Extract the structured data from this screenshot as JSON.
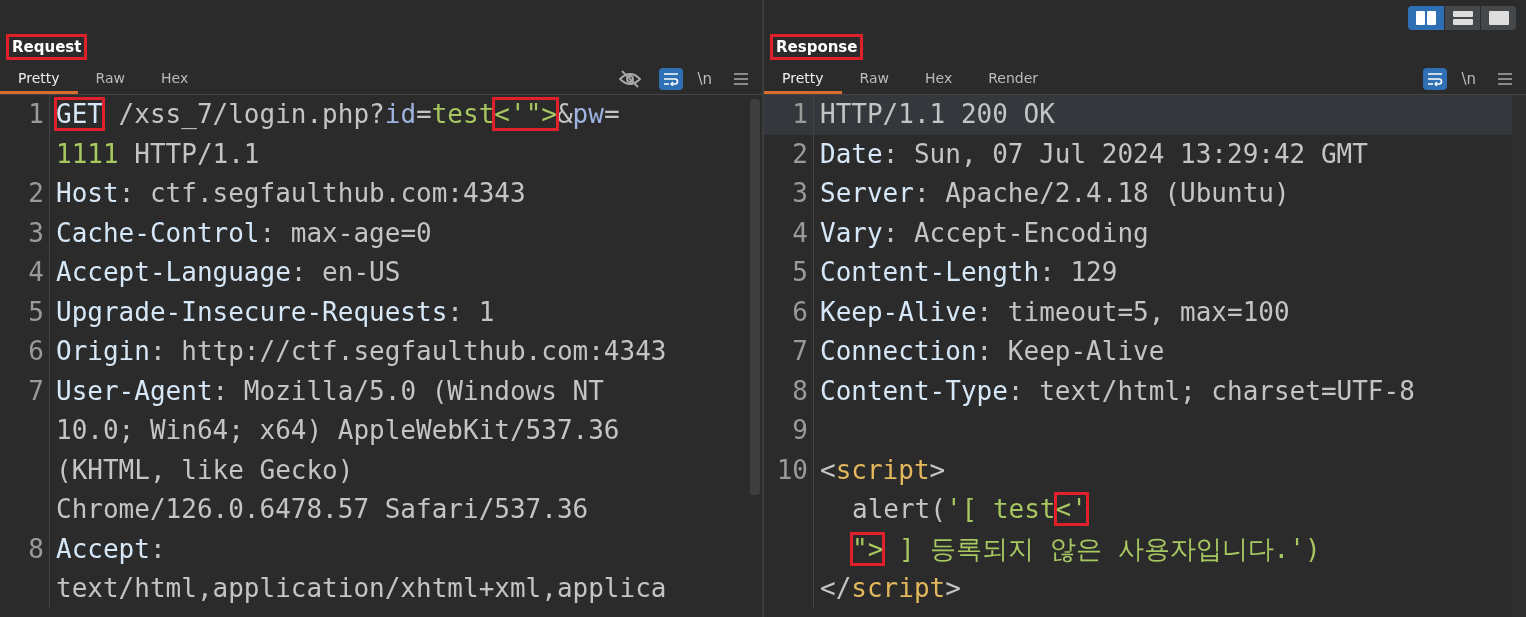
{
  "panes": [
    {
      "title": "Request",
      "title_marked": true,
      "tabs": [
        {
          "label": "Pretty",
          "selected": true
        },
        {
          "label": "Raw",
          "selected": false
        },
        {
          "label": "Hex",
          "selected": false
        }
      ],
      "tools": [
        {
          "kind": "eye"
        },
        {
          "kind": "wrap",
          "on": true
        },
        {
          "kind": "newline",
          "label": "\\n"
        },
        {
          "kind": "menu"
        }
      ],
      "rows": [
        {
          "number": "1",
          "segs": [
            {
              "text": "GET",
              "kind": "key",
              "marked": true
            },
            {
              "text": " /xss_7/login.php?",
              "kind": "plain",
              "marked": false
            },
            {
              "text": "id",
              "kind": "param",
              "marked": false
            },
            {
              "text": "=",
              "kind": "plain",
              "marked": false
            },
            {
              "text": "test",
              "kind": "green",
              "marked": false
            },
            {
              "text": "<'\">",
              "kind": "green",
              "marked": true
            },
            {
              "text": "&",
              "kind": "plain",
              "marked": false
            },
            {
              "text": "pw",
              "kind": "param",
              "marked": false
            },
            {
              "text": "=",
              "kind": "plain",
              "marked": false
            }
          ]
        },
        {
          "segs": [
            {
              "text": "1111",
              "kind": "green",
              "marked": false
            },
            {
              "text": " HTTP/1.1",
              "kind": "plain",
              "marked": false
            }
          ]
        },
        {
          "number": "2",
          "segs": [
            {
              "text": "Host",
              "kind": "key",
              "marked": false
            },
            {
              "text": ": ctf.segfaulthub.com:4343",
              "kind": "plain",
              "marked": false
            }
          ]
        },
        {
          "number": "3",
          "segs": [
            {
              "text": "Cache-Control",
              "kind": "key",
              "marked": false
            },
            {
              "text": ": max-age=0",
              "kind": "plain",
              "marked": false
            }
          ]
        },
        {
          "number": "4",
          "segs": [
            {
              "text": "Accept-Language",
              "kind": "key",
              "marked": false
            },
            {
              "text": ": en-US",
              "kind": "plain",
              "marked": false
            }
          ]
        },
        {
          "number": "5",
          "segs": [
            {
              "text": "Upgrade-Insecure-Requests",
              "kind": "key",
              "marked": false
            },
            {
              "text": ": 1",
              "kind": "plain",
              "marked": false
            }
          ]
        },
        {
          "number": "6",
          "segs": [
            {
              "text": "Origin",
              "kind": "key",
              "marked": false
            },
            {
              "text": ": http://ctf.segfaulthub.com:4343",
              "kind": "plain",
              "marked": false
            }
          ]
        },
        {
          "number": "7",
          "segs": [
            {
              "text": "User-Agent",
              "kind": "key",
              "marked": false
            },
            {
              "text": ": Mozilla/5.0 (Windows NT",
              "kind": "plain",
              "marked": false
            }
          ]
        },
        {
          "segs": [
            {
              "text": "10.0; Win64; x64) AppleWebKit/537.36",
              "kind": "plain",
              "marked": false
            }
          ]
        },
        {
          "segs": [
            {
              "text": "(KHTML, like Gecko)",
              "kind": "plain",
              "marked": false
            }
          ]
        },
        {
          "segs": [
            {
              "text": "Chrome/126.0.6478.57 Safari/537.36",
              "kind": "plain",
              "marked": false
            }
          ]
        },
        {
          "number": "8",
          "segs": [
            {
              "text": "Accept",
              "kind": "key",
              "marked": false
            },
            {
              "text": ":",
              "kind": "plain",
              "marked": false
            }
          ]
        },
        {
          "segs": [
            {
              "text": "text/html,application/xhtml+xml,applica",
              "kind": "plain",
              "marked": false
            }
          ]
        }
      ]
    },
    {
      "title": "Response",
      "title_marked": true,
      "view_toggle": [
        {
          "kind": "columns",
          "selected": true
        },
        {
          "kind": "rows",
          "selected": false
        },
        {
          "kind": "single",
          "selected": false
        }
      ],
      "tabs": [
        {
          "label": "Pretty",
          "selected": true
        },
        {
          "label": "Raw",
          "selected": false
        },
        {
          "label": "Hex",
          "selected": false
        },
        {
          "label": "Render",
          "selected": false
        }
      ],
      "tools": [
        {
          "kind": "wrap",
          "on": true
        },
        {
          "kind": "newline",
          "label": "\\n"
        },
        {
          "kind": "menu"
        }
      ],
      "rows": [
        {
          "number": "1",
          "current": true,
          "segs": [
            {
              "text": "HTTP/1.1 200 OK",
              "kind": "plain",
              "marked": false
            }
          ]
        },
        {
          "number": "2",
          "segs": [
            {
              "text": "Date",
              "kind": "key",
              "marked": false
            },
            {
              "text": ": Sun, 07 Jul 2024 13:29:42 GMT",
              "kind": "plain",
              "marked": false
            }
          ]
        },
        {
          "number": "3",
          "segs": [
            {
              "text": "Server",
              "kind": "key",
              "marked": false
            },
            {
              "text": ": Apache/2.4.18 (Ubuntu)",
              "kind": "plain",
              "marked": false
            }
          ]
        },
        {
          "number": "4",
          "segs": [
            {
              "text": "Vary",
              "kind": "key",
              "marked": false
            },
            {
              "text": ": Accept-Encoding",
              "kind": "plain",
              "marked": false
            }
          ]
        },
        {
          "number": "5",
          "segs": [
            {
              "text": "Content-Length",
              "kind": "key",
              "marked": false
            },
            {
              "text": ": 129",
              "kind": "plain",
              "marked": false
            }
          ]
        },
        {
          "number": "6",
          "segs": [
            {
              "text": "Keep-Alive",
              "kind": "key",
              "marked": false
            },
            {
              "text": ": timeout=5, max=100",
              "kind": "plain",
              "marked": false
            }
          ]
        },
        {
          "number": "7",
          "segs": [
            {
              "text": "Connection",
              "kind": "key",
              "marked": false
            },
            {
              "text": ": Keep-Alive",
              "kind": "plain",
              "marked": false
            }
          ]
        },
        {
          "number": "8",
          "segs": [
            {
              "text": "Content-Type",
              "kind": "key",
              "marked": false
            },
            {
              "text": ": text/html; charset=UTF-8",
              "kind": "plain",
              "marked": false
            }
          ]
        },
        {
          "number": "9",
          "segs": []
        },
        {
          "number": "10",
          "segs": [
            {
              "text": "<",
              "kind": "plain",
              "marked": false
            },
            {
              "text": "script",
              "kind": "tag",
              "marked": false
            },
            {
              "text": ">",
              "kind": "plain",
              "marked": false
            }
          ]
        },
        {
          "indented": true,
          "segs": [
            {
              "text": "alert(",
              "kind": "plain",
              "marked": false
            },
            {
              "text": "'[ test",
              "kind": "green",
              "marked": false
            },
            {
              "text": "<'",
              "kind": "green",
              "marked": true
            }
          ]
        },
        {
          "indented": true,
          "segs": [
            {
              "text": "\">",
              "kind": "green",
              "marked": true
            },
            {
              "text": " ] 등록되지 않은 사용자입니다.')",
              "kind": "green",
              "marked": false
            }
          ]
        },
        {
          "segs": [
            {
              "text": "</",
              "kind": "plain",
              "marked": false
            },
            {
              "text": "script",
              "kind": "tag",
              "marked": false
            },
            {
              "text": ">",
              "kind": "plain",
              "marked": false
            }
          ]
        }
      ]
    }
  ]
}
